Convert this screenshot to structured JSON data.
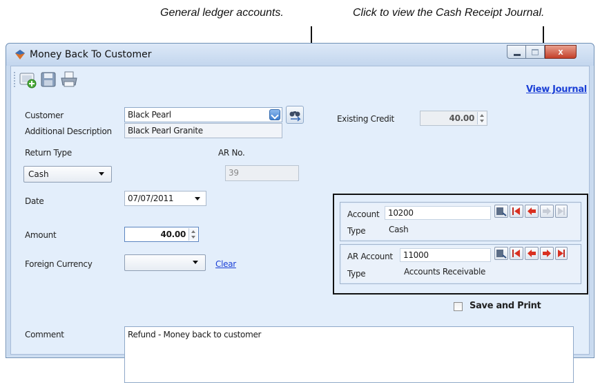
{
  "callouts": {
    "gl_accounts": "General ledger accounts.",
    "view_journal": "Click to view the Cash Receipt Journal."
  },
  "window": {
    "title": "Money Back To Customer",
    "close_label": "x"
  },
  "toolbar": {
    "icons": [
      "new-record-icon",
      "save-icon",
      "print-icon"
    ]
  },
  "view_journal_label": "View Journal",
  "customer": {
    "label": "Customer",
    "value": "Black Pearl",
    "additional_label": "Additional Description",
    "additional_value": "Black Pearl Granite"
  },
  "existing_credit": {
    "label": "Existing Credit",
    "value": "40.00"
  },
  "return_type": {
    "label": "Return Type",
    "value": "Cash"
  },
  "ar_no": {
    "label": "AR No.",
    "value": "39"
  },
  "date": {
    "label": "Date",
    "value": "07/07/2011"
  },
  "amount": {
    "label": "Amount",
    "value": "40.00"
  },
  "foreign_currency": {
    "label": "Foreign Currency",
    "value": "",
    "clear_label": "Clear"
  },
  "account": {
    "label": "Account",
    "value": "10200",
    "type_label": "Type",
    "type_value": "Cash"
  },
  "ar_account": {
    "label": "AR Account",
    "value": "11000",
    "type_label": "Type",
    "type_value": "Accounts Receivable"
  },
  "save_and_print": {
    "label": "Save and Print",
    "checked": false
  },
  "comment": {
    "label": "Comment",
    "value": "Refund - Money back to customer"
  },
  "colors": {
    "client_bg": "#e3eefb",
    "link": "#1a3fd6",
    "combo_accent": "#3f7fcf"
  }
}
